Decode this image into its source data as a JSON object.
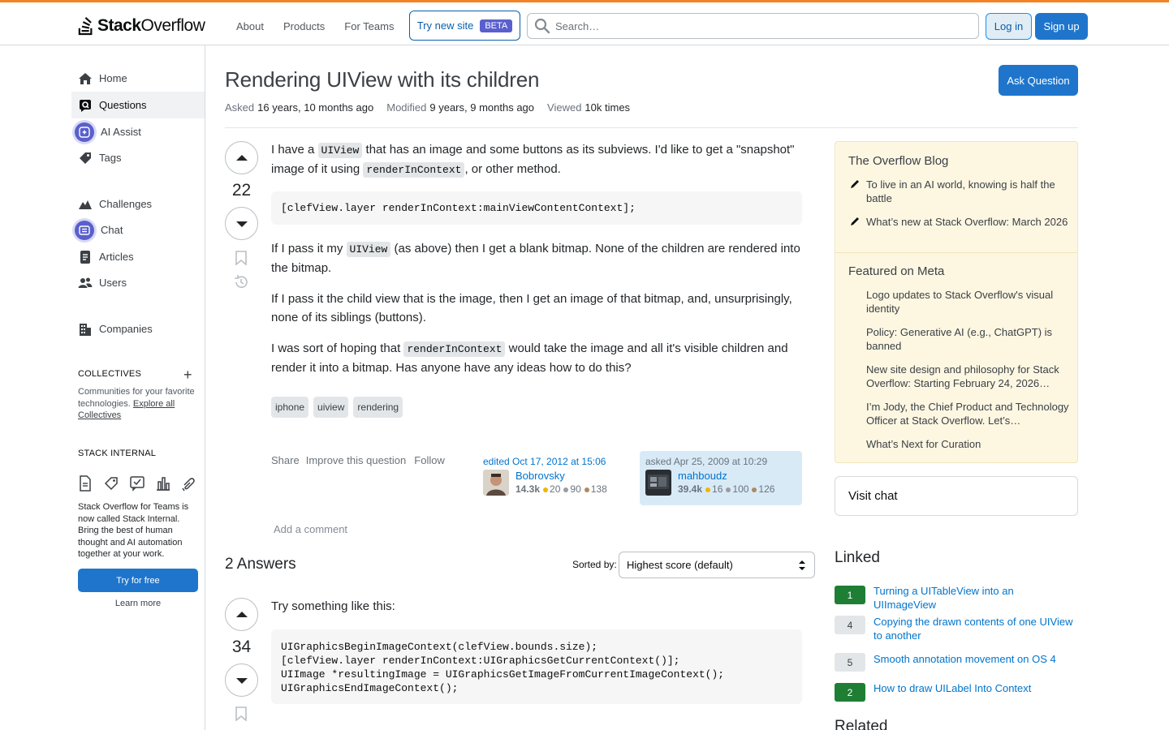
{
  "header": {
    "logo_bold": "Stack",
    "logo_rest": "Overflow",
    "nav": [
      "About",
      "Products",
      "For Teams"
    ],
    "try_new": "Try new site",
    "beta": "BETA",
    "search_placeholder": "Search…",
    "login": "Log in",
    "signup": "Sign up"
  },
  "sidebar": {
    "items": [
      "Home",
      "Questions",
      "AI Assist",
      "Tags",
      "Challenges",
      "Chat",
      "Articles",
      "Users",
      "Companies"
    ],
    "collectives_title": "COLLECTIVES",
    "collectives_text": "Communities for your favorite technologies.",
    "collectives_link": "Explore all Collectives",
    "internal_title": "STACK INTERNAL",
    "internal_text": "Stack Overflow for Teams is now called Stack Internal. Bring the best of human thought and AI automation together at your work.",
    "try_free": "Try for free",
    "learn_more": "Learn more"
  },
  "question": {
    "title": "Rendering UIView with its children",
    "ask_button": "Ask Question",
    "asked_label": "Asked",
    "asked_value": "16 years, 10 months ago",
    "modified_label": "Modified",
    "modified_value": "9 years, 9 months ago",
    "viewed_label": "Viewed",
    "viewed_value": "10k times",
    "score": "22",
    "p1_a": "I have a ",
    "p1_code1": "UIView",
    "p1_b": " that has an image and some buttons as its subviews. I'd like to get a \"snapshot\" image of it using ",
    "p1_code2": "renderInContext",
    "p1_c": ", or other method.",
    "code": "[clefView.layer renderInContext:mainViewContentContext];",
    "p2_a": "If I pass it my ",
    "p2_code": "UIView",
    "p2_b": " (as above) then I get a blank bitmap. None of the children are rendered into the bitmap.",
    "p3": "If I pass it the child view that is the image, then I get an image of that bitmap, and, unsurprisingly, none of its siblings (buttons).",
    "p4_a": "I was sort of hoping that ",
    "p4_code": "renderInContext",
    "p4_b": " would take the image and all it's visible children and render it into a bitmap. Has anyone have any ideas how to do this?",
    "tags": [
      "iphone",
      "uiview",
      "rendering"
    ],
    "actions": [
      "Share",
      "Improve this question",
      "Follow"
    ],
    "edited": {
      "time": "edited Oct 17, 2012 at 15:06",
      "name": "Bobrovsky",
      "rep": "14.3k",
      "gold": "20",
      "silver": "90",
      "bronze": "138"
    },
    "asked": {
      "time": "asked Apr 25, 2009 at 10:29",
      "name": "mahboudz",
      "rep": "39.4k",
      "gold": "16",
      "silver": "100",
      "bronze": "126"
    },
    "add_comment": "Add a comment"
  },
  "answers": {
    "heading": "2 Answers",
    "sorted_by": "Sorted by:",
    "sort_value": "Highest score (default)",
    "first": {
      "score": "34",
      "intro": "Try something like this:",
      "code": "UIGraphicsBeginImageContext(clefView.bounds.size);\n[clefView.layer renderInContext:UIGraphicsGetCurrentContext()];\nUIImage *resultingImage = UIGraphicsGetImageFromCurrentImageContext();\nUIGraphicsEndImageContext();"
    }
  },
  "right": {
    "blog_title": "The Overflow Blog",
    "blog_items": [
      "To live in an AI world, knowing is half the battle",
      "What’s new at Stack Overflow: March 2026"
    ],
    "meta_title": "Featured on Meta",
    "meta_items": [
      "Logo updates to Stack Overflow's visual identity",
      "Policy: Generative AI (e.g., ChatGPT) is banned",
      "New site design and philosophy for Stack Overflow: Starting February 24, 2026…",
      "I’m Jody, the Chief Product and Technology Officer at Stack Overflow. Let’s…",
      "What’s Next for Curation"
    ],
    "visit_chat": "Visit chat",
    "linked_title": "Linked",
    "linked": [
      {
        "score": "1",
        "text": "Turning a UITableView into an UIImageView",
        "accepted": true
      },
      {
        "score": "4",
        "text": "Copying the drawn contents of one UIView to another",
        "accepted": false
      },
      {
        "score": "5",
        "text": "Smooth annotation movement on OS 4",
        "accepted": false
      },
      {
        "score": "2",
        "text": "How to draw UILabel Into Context",
        "accepted": true
      }
    ],
    "related_title": "Related"
  },
  "colors": {
    "accent": "#f48225",
    "primary": "#1f75cb",
    "link": "#0074cc"
  }
}
